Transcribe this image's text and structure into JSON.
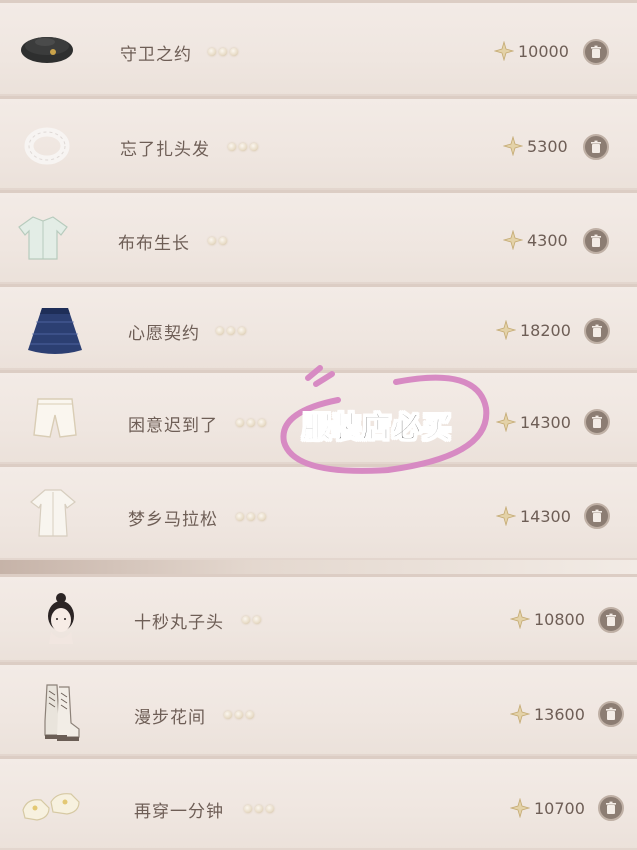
{
  "items": [
    {
      "name": "守卫之约",
      "stars": 3,
      "price": "10000",
      "icon": "beret-hat-icon"
    },
    {
      "name": "忘了扎头发",
      "stars": 3,
      "price": "5300",
      "icon": "hair-scrunchie-icon"
    },
    {
      "name": "布布生长",
      "stars": 2,
      "price": "4300",
      "icon": "green-jacket-icon"
    },
    {
      "name": "心愿契约",
      "stars": 3,
      "price": "18200",
      "icon": "blue-skirt-icon"
    },
    {
      "name": "困意迟到了",
      "stars": 3,
      "price": "14300",
      "icon": "shorts-icon"
    },
    {
      "name": "梦乡马拉松",
      "stars": 3,
      "price": "14300",
      "icon": "white-outfit-icon"
    },
    {
      "name": "十秒丸子头",
      "stars": 2,
      "price": "10800",
      "icon": "bun-hairstyle-icon"
    },
    {
      "name": "漫步花间",
      "stars": 3,
      "price": "13600",
      "icon": "lace-boots-icon"
    },
    {
      "name": "再穿一分钟",
      "stars": 3,
      "price": "10700",
      "icon": "shoes-icon"
    }
  ],
  "overlay": {
    "text": "服装店必买",
    "ring_color": "#d78ac3"
  },
  "colors": {
    "text": "#6e5e56",
    "trash_bg": "#8c7d73",
    "row_bg": "#efe6e0"
  }
}
